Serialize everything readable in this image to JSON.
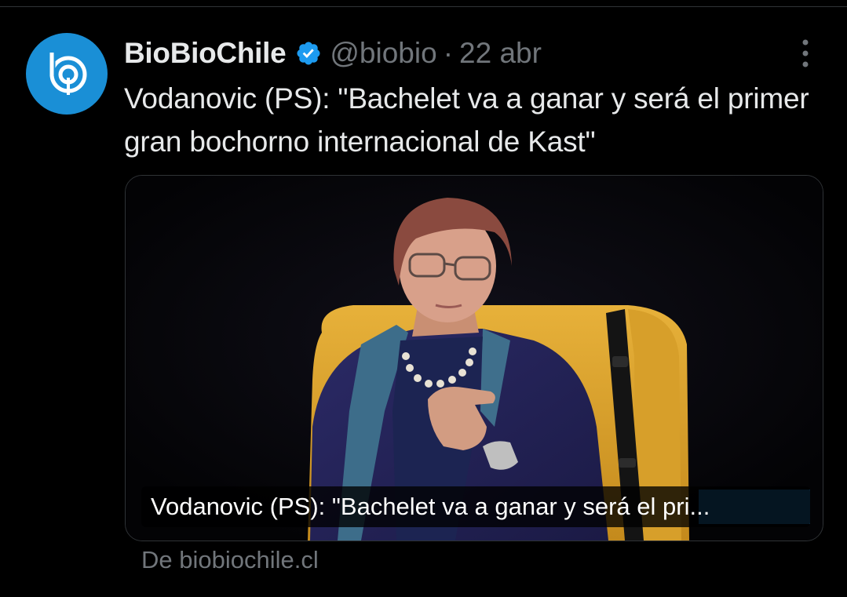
{
  "tweet": {
    "display_name": "BioBioChile",
    "handle": "@biobio",
    "separator": "·",
    "date": "22 abr",
    "text": "Vodanovic (PS): \"Bachelet va a ganar y será el primer gran bochorno internacional de Kast\"",
    "avatar_icon": "biobiochile-logo-icon",
    "verified_icon": "verified-badge-icon",
    "more_icon": "more-options-icon"
  },
  "card": {
    "caption": "Vodanovic (PS): \"Bachelet va a ganar y será el pri...",
    "source": "De biobiochile.cl"
  },
  "colors": {
    "background": "#000000",
    "text": "#e7e9ea",
    "muted": "#71767b",
    "verified": "#1d9bf0",
    "avatar": "#1a8fd6"
  }
}
